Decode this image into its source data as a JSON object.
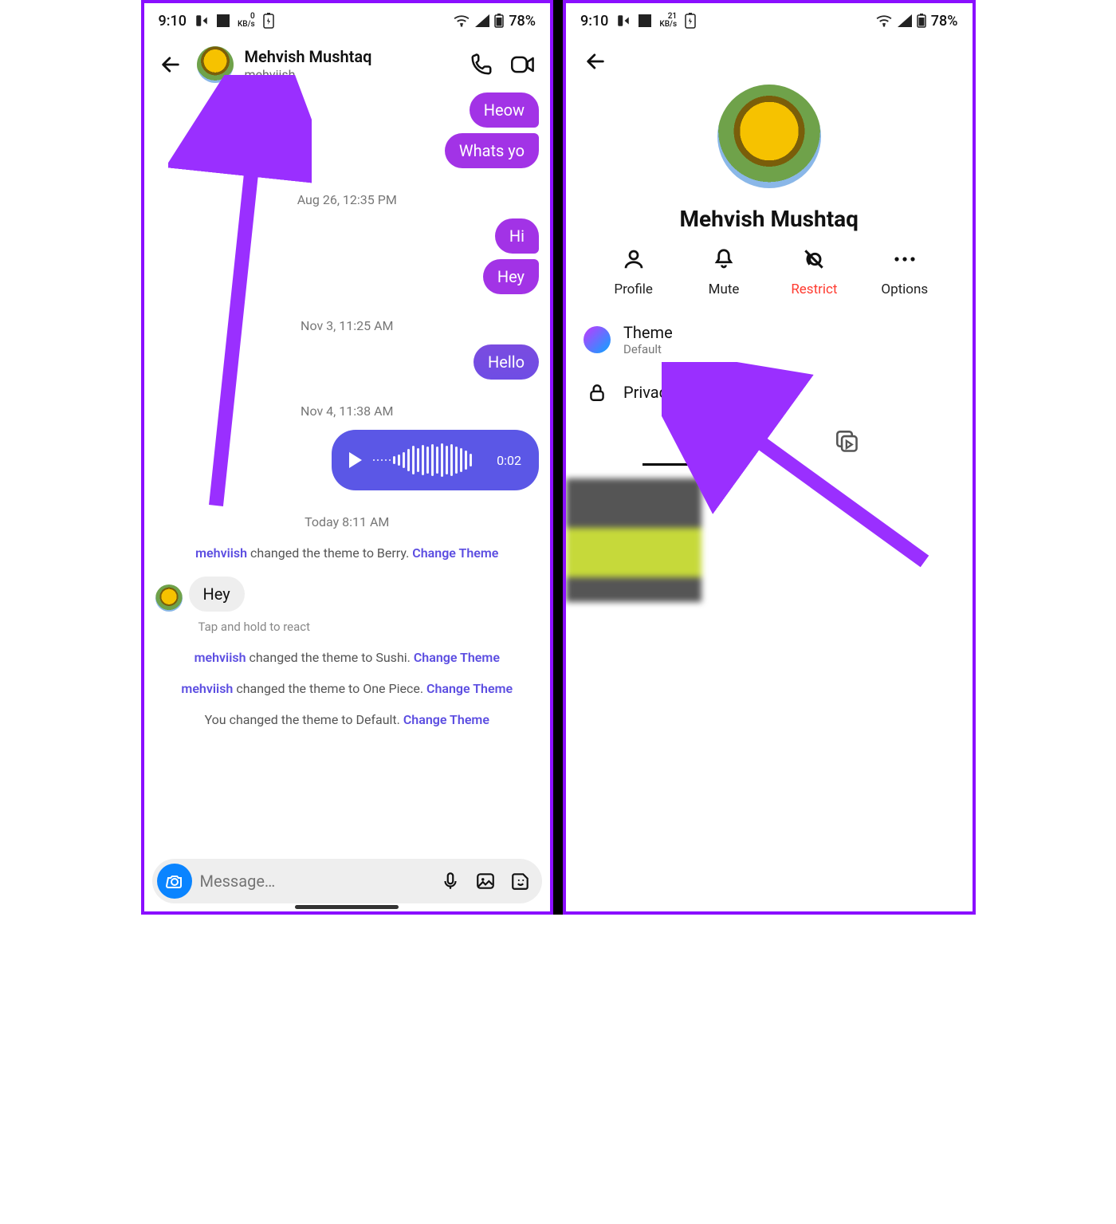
{
  "status": {
    "time": "9:10",
    "kbs_left": "0",
    "kbs_right": "21",
    "kbs_unit": "KB/s",
    "battery": "78%"
  },
  "chat": {
    "contact_name": "Mehvish Mushtaq",
    "contact_handle": "mehviish",
    "messages": {
      "heow": "Heow",
      "whats": "Whats yo",
      "hi": "Hi",
      "hey": "Hey",
      "hello": "Hello",
      "hey_in": "Hey"
    },
    "timestamps": {
      "t1": "Aug 26, 12:35 PM",
      "t2": "Nov 3, 11:25 AM",
      "t3": "Nov 4, 11:38 AM",
      "t4": "Today 8:11 AM"
    },
    "voice_duration": "0:02",
    "tap_hint": "Tap and hold to react",
    "system": {
      "berry_user": "mehviish",
      "berry_text": " changed the theme to Berry. ",
      "sushi_user": "mehviish",
      "sushi_text": " changed the theme to Sushi. ",
      "onepiece_user": "mehviish",
      "onepiece_text": " changed the theme to One Piece. ",
      "default_text": "You changed the theme to Default. ",
      "change_link": "Change Theme"
    },
    "composer_placeholder": "Message…"
  },
  "profile": {
    "name": "Mehvish Mushtaq",
    "actions": {
      "profile": "Profile",
      "mute": "Mute",
      "restrict": "Restrict",
      "options": "Options"
    },
    "theme_label": "Theme",
    "theme_value": "Default",
    "privacy_label": "Privacy & safety"
  }
}
